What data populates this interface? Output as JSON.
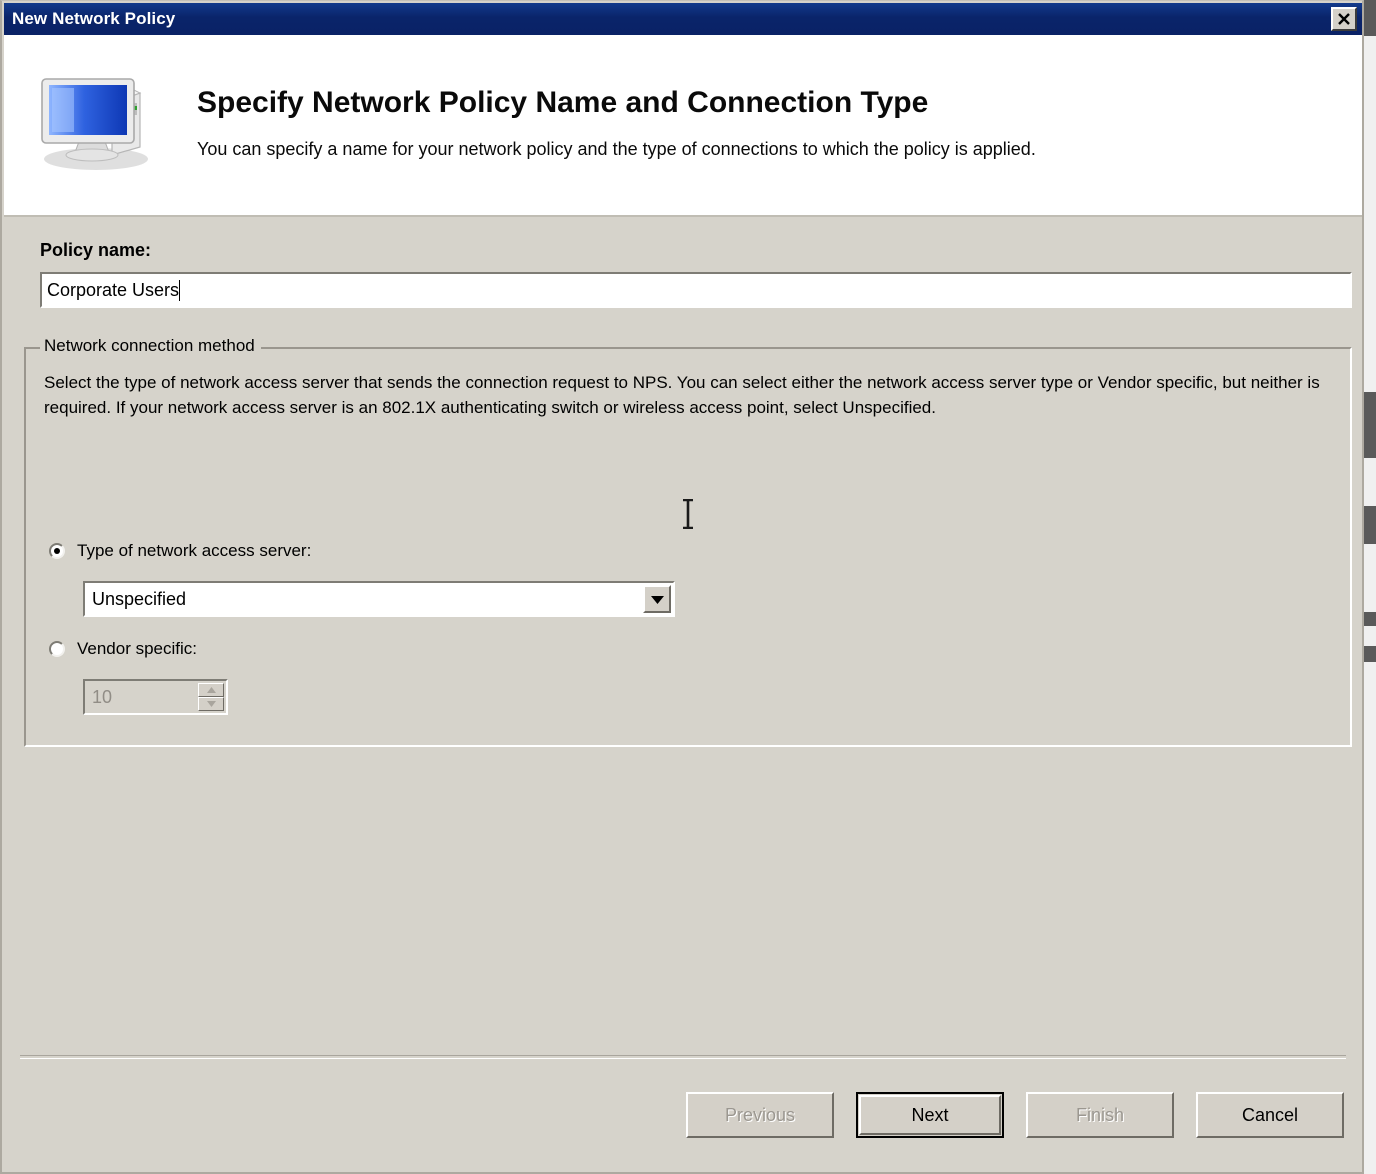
{
  "window": {
    "title": "New Network Policy",
    "close_icon": "close-x-icon"
  },
  "header": {
    "icon": "computer-monitor-server-icon",
    "title": "Specify Network Policy Name and Connection Type",
    "subtitle": "You can specify a name for your network policy and the type of connections to which the policy is applied."
  },
  "form": {
    "policy_name_label": "Policy name:",
    "policy_name_value": "Corporate Users",
    "policy_name_placeholder": ""
  },
  "group": {
    "legend": "Network connection method",
    "description": "Select the type of network access server that sends the connection request to NPS. You can select either the network access server type or Vendor specific, but neither is required.  If your network access server is an 802.1X authenticating switch or wireless access point, select Unspecified.",
    "radio_nas_type_label": "Type of network access server:",
    "radio_vendor_label": "Vendor specific:",
    "nas_type_selected": "Unspecified",
    "nas_type_options": [
      "Unspecified"
    ],
    "vendor_specific_value": "10",
    "dropdown_icon": "chevron-down-icon",
    "spinner_up_icon": "chevron-up-icon",
    "spinner_down_icon": "chevron-down-icon"
  },
  "footer": {
    "previous_label": "Previous",
    "next_label": "Next",
    "finish_label": "Finish",
    "cancel_label": "Cancel"
  },
  "colors": {
    "titlebar": "#0a246a",
    "dialog_face": "#d6d3cb",
    "button_face": "#d4d0c8",
    "disabled_text": "#9b9790",
    "field_background": "#ffffff"
  }
}
